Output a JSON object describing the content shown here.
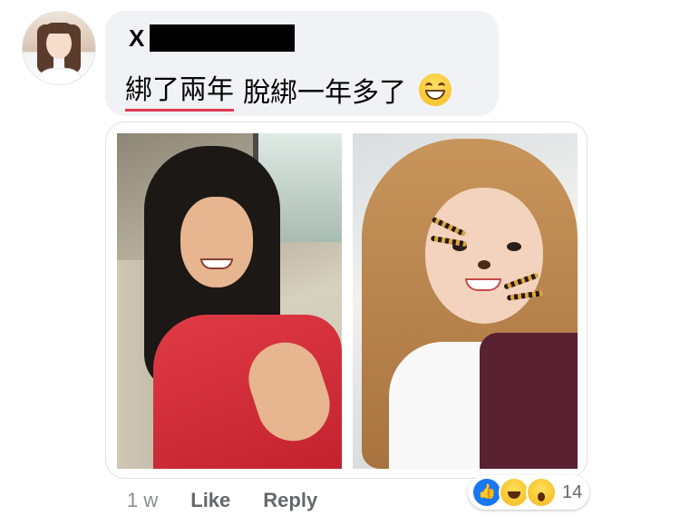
{
  "comment": {
    "author_visible": "X",
    "text_underlined": "綁了兩年",
    "text_rest": "脫綁一年多了",
    "emoji": "grinning-face-with-smiling-eyes",
    "underline_color": "#e53950"
  },
  "attachment": {
    "photos": [
      "photo-left",
      "photo-right"
    ]
  },
  "meta": {
    "time": "1 w",
    "like_label": "Like",
    "reply_label": "Reply"
  },
  "reactions": {
    "icons": [
      "like-reaction-icon",
      "haha-reaction-icon",
      "wow-reaction-icon"
    ],
    "count": "14",
    "like_color": "#1877f2"
  }
}
